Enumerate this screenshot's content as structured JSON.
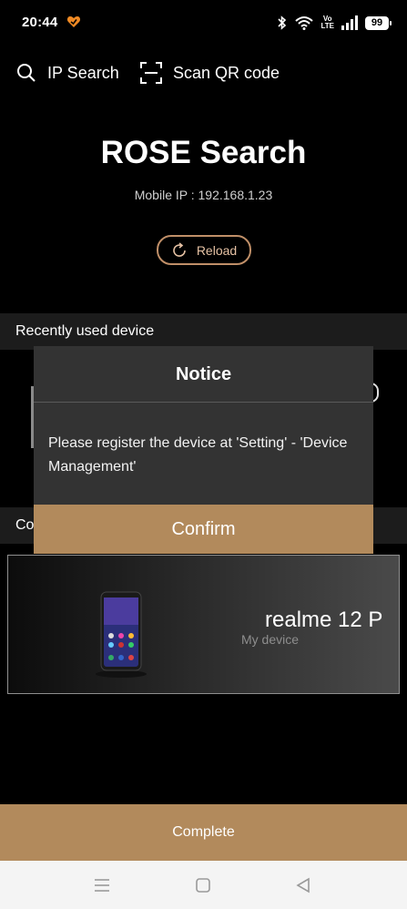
{
  "status_bar": {
    "time": "20:44",
    "volte_top": "Vo",
    "volte_bottom": "LTE",
    "battery": "99"
  },
  "top_actions": {
    "ip_search": "IP Search",
    "scan_qr": "Scan QR code"
  },
  "header": {
    "title": "ROSE Search",
    "mobile_ip": "Mobile IP : 192.168.1.23",
    "reload": "Reload"
  },
  "sections": {
    "recent": "Recently used device",
    "connected_partial": "Co"
  },
  "device_card": {
    "name": "realme 12 P",
    "subtitle": "My device"
  },
  "dialog": {
    "title": "Notice",
    "message": "Please register the device at 'Setting' - 'Device Management'",
    "confirm": "Confirm"
  },
  "footer": {
    "complete": "Complete"
  },
  "colors": {
    "accent": "#b28a5c",
    "reload_border": "#c08f68",
    "dialog_bg": "#333333"
  }
}
